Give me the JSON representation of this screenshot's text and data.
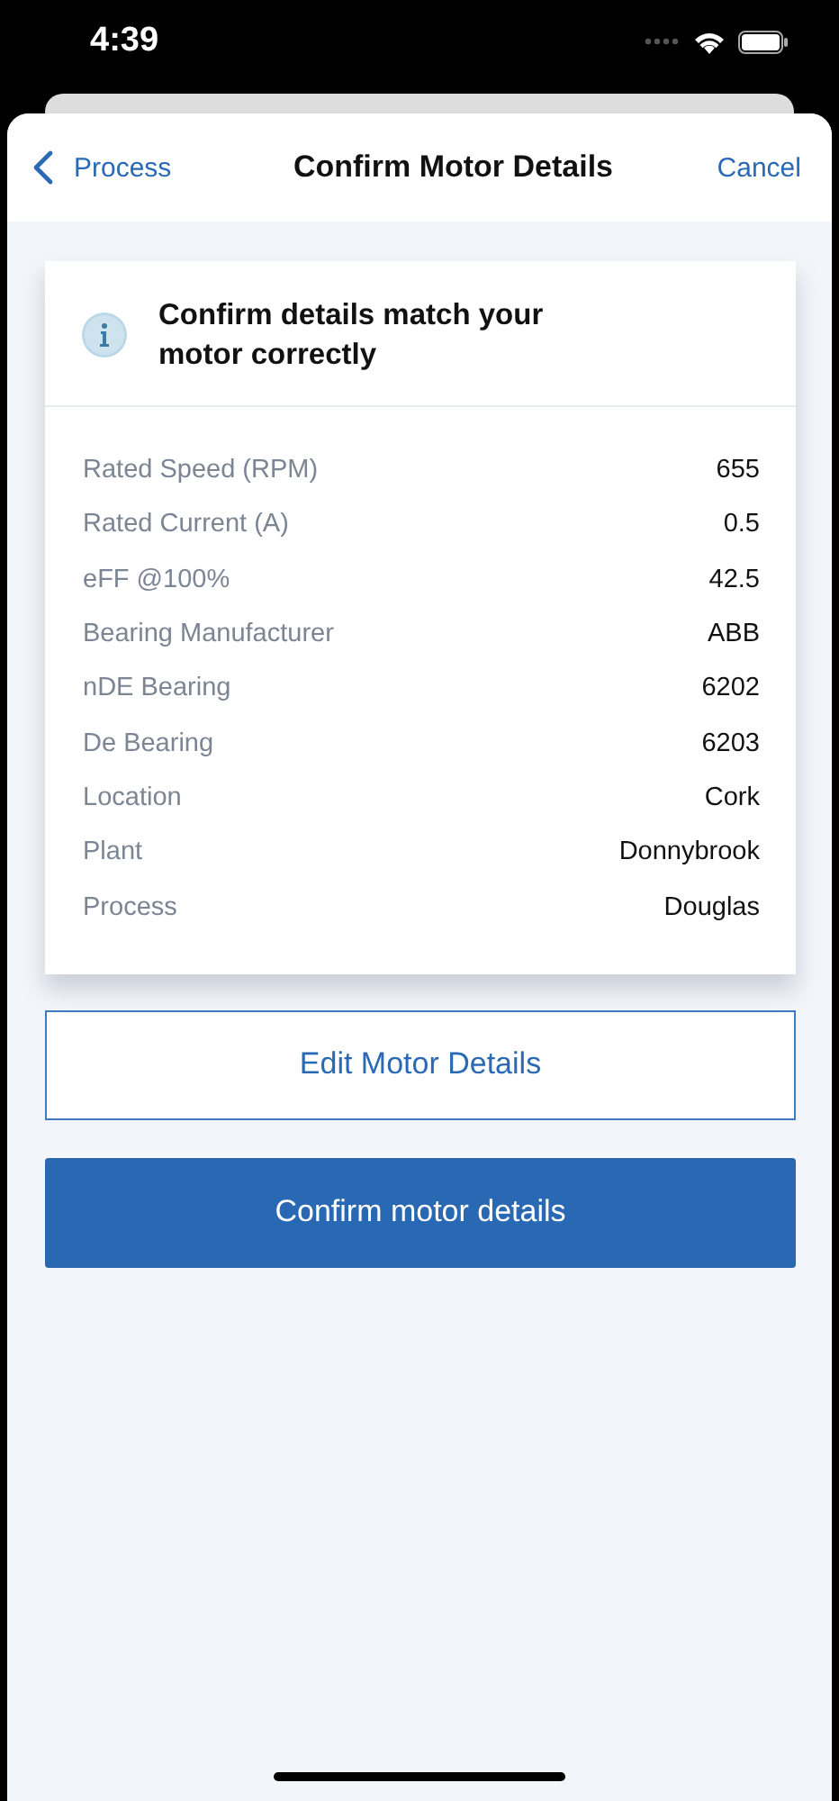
{
  "status_bar": {
    "time": "4:39"
  },
  "nav": {
    "back": "Process",
    "title": "Confirm Motor Details",
    "action": "Cancel"
  },
  "card": {
    "heading": "Confirm details match your motor correctly",
    "rows": [
      {
        "label": "Rated Speed (RPM)",
        "value": "655"
      },
      {
        "label": "Rated Current (A)",
        "value": "0.5"
      },
      {
        "label": "eFF @100%",
        "value": "42.5"
      },
      {
        "label": "Bearing Manufacturer",
        "value": "ABB"
      },
      {
        "label": "nDE Bearing",
        "value": "6202"
      },
      {
        "label": "De Bearing",
        "value": "6203"
      },
      {
        "label": "Location",
        "value": "Cork"
      },
      {
        "label": "Plant",
        "value": "Donnybrook"
      },
      {
        "label": "Process",
        "value": "Douglas"
      }
    ]
  },
  "buttons": [
    {
      "label": "Edit Motor Details",
      "kind": "outline"
    },
    {
      "label": "Confirm motor details",
      "kind": "primary"
    }
  ]
}
